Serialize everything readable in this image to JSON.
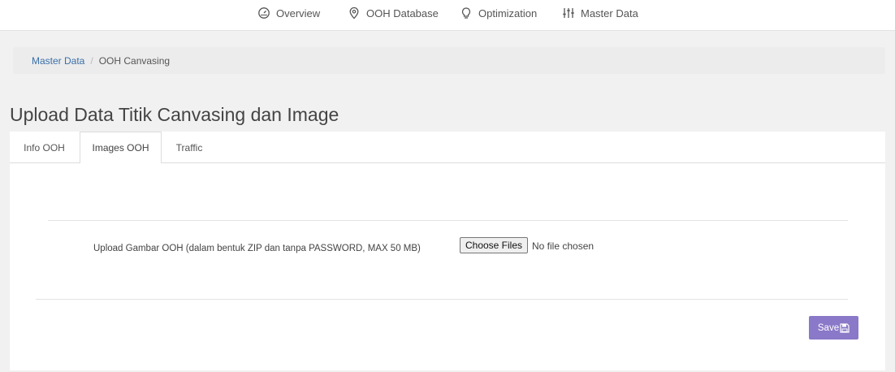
{
  "nav": {
    "items": [
      {
        "label": "Overview",
        "icon": "gauge-icon"
      },
      {
        "label": "OOH Database",
        "icon": "map-pin-icon"
      },
      {
        "label": "Optimization",
        "icon": "lightbulb-icon"
      },
      {
        "label": "Master Data",
        "icon": "sliders-icon"
      }
    ]
  },
  "breadcrumb": {
    "parent": "Master Data",
    "separator": "/",
    "current": "OOH Canvasing"
  },
  "page": {
    "title": "Upload Data Titik Canvasing dan Image"
  },
  "tabs": [
    {
      "label": "Info OOH",
      "active": false
    },
    {
      "label": "Images OOH",
      "active": true
    },
    {
      "label": "Traffic",
      "active": false
    }
  ],
  "form": {
    "upload_label": "Upload Gambar OOH (dalam bentuk ZIP dan tanpa PASSWORD, MAX 50 MB)",
    "choose_files_label": "Choose Files",
    "file_status": "No file chosen",
    "save_label": "Save",
    "save_icon": "floppy-disk-icon"
  },
  "colors": {
    "accent": "#8a78c8",
    "link": "#3a6fa8",
    "background": "#f1f1f1"
  }
}
